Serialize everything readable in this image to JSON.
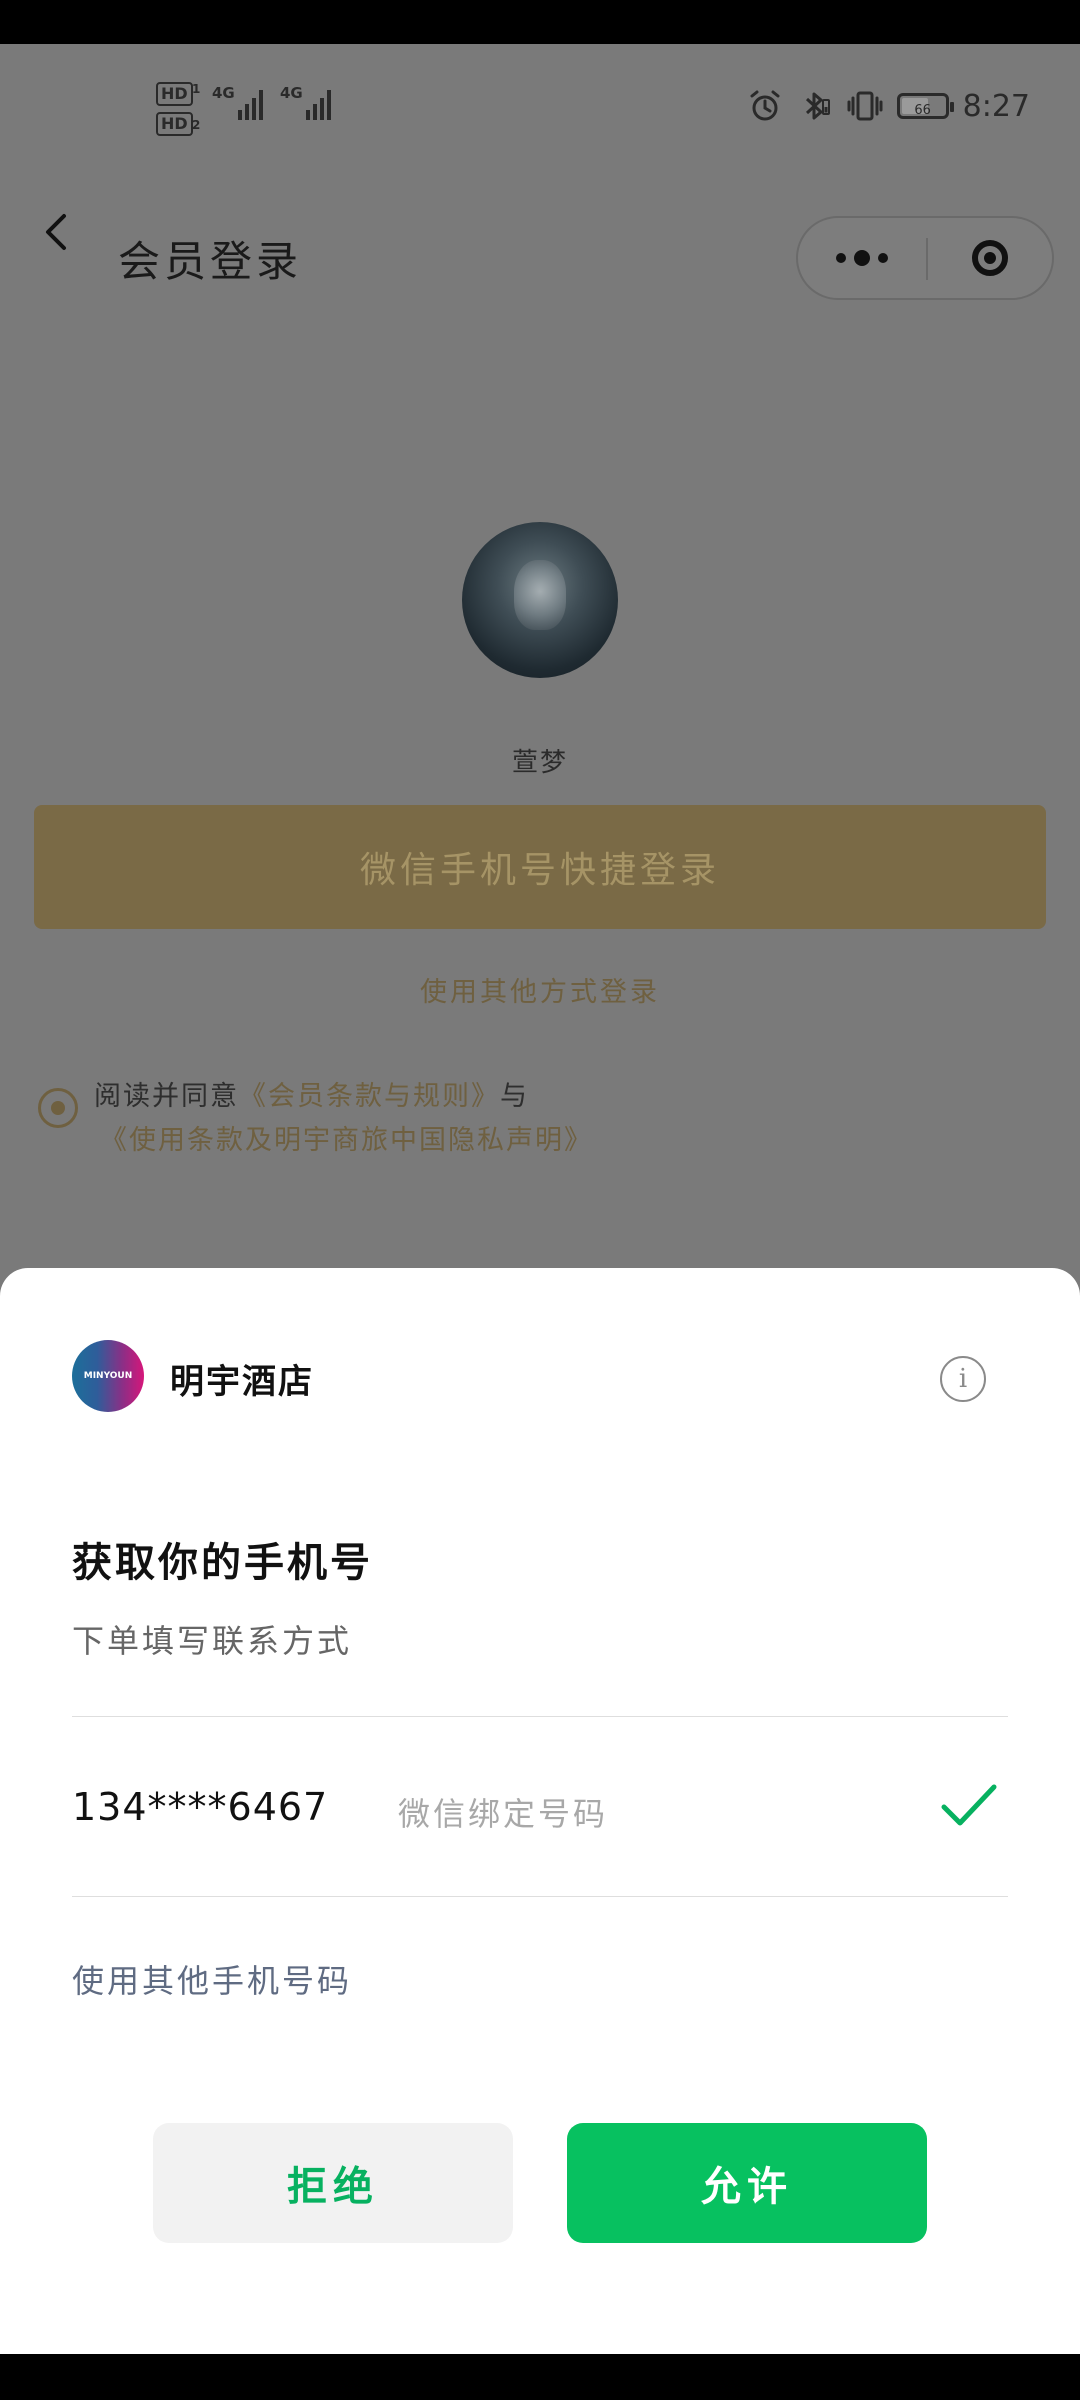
{
  "status_bar": {
    "sim1_badge": "HD",
    "sim1_index": "1",
    "sim2_badge": "HD",
    "sim2_index": "2",
    "network1": "4G",
    "network2": "4G",
    "battery_level": "66",
    "time": "8:27",
    "icons": [
      "alarm-icon",
      "bluetooth-icon",
      "vibrate-icon",
      "battery-icon"
    ]
  },
  "nav": {
    "title": "会员登录",
    "back_icon": "chevron-left-icon",
    "more_icon": "more-dots-icon",
    "close_icon": "target-close-icon"
  },
  "page": {
    "user_name": "萱梦",
    "quick_login_label": "微信手机号快捷登录",
    "other_login_label": "使用其他方式登录",
    "agreement_prefix": "阅读并同意",
    "terms_member": "《会员条款与规则》",
    "agreement_joiner": "与",
    "terms_privacy": "《使用条款及明宇商旅中国隐私声明》"
  },
  "sheet": {
    "app_logo_text": "MINYOUN",
    "app_name": "明宇酒店",
    "info_icon_text": "i",
    "title": "获取你的手机号",
    "subtitle": "下单填写联系方式",
    "phone_number": "134****6467",
    "phone_tag": "微信绑定号码",
    "other_phone_label": "使用其他手机号码",
    "deny_label": "拒绝",
    "allow_label": "允许"
  },
  "colors": {
    "allow_green": "#07c160",
    "check_green": "#07b160",
    "gold_accent": "#6f6040",
    "overlay_gray": "#7a7a7a"
  }
}
